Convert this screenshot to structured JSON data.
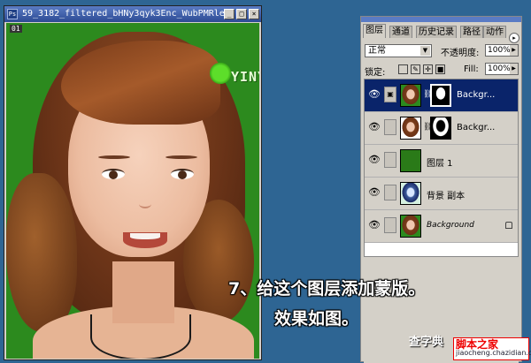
{
  "document": {
    "title": "59_3182_filtered_bHNy3qyk3Enc_WubPMRle...",
    "layer_tag": "01",
    "minimize": "_",
    "maximize": "□",
    "close": "×"
  },
  "logo": {
    "text": "YINYIN"
  },
  "panel": {
    "tabs": [
      "图层",
      "通道",
      "历史记录",
      "路径",
      "动作"
    ],
    "menu_button": "▸",
    "blend_mode": "正常",
    "opacity_label": "不透明度:",
    "opacity_value": "100%",
    "lock_label": "锁定:",
    "fill_label": "Fill:",
    "fill_value": "100%",
    "layers": [
      {
        "name": "Backgr...",
        "selected": true,
        "has_mask": true
      },
      {
        "name": "Backgr...",
        "selected": false,
        "has_mask": true
      },
      {
        "name": "图层 1",
        "selected": false,
        "has_mask": false
      },
      {
        "name": "背景 副本",
        "selected": false,
        "has_mask": false
      },
      {
        "name": "Background",
        "selected": false,
        "has_mask": false,
        "locked": true
      }
    ]
  },
  "caption": {
    "line1": "7、给这个图层添加蒙版。",
    "line2": "效果如图。"
  },
  "watermark": {
    "top": "脚本之家",
    "bottom": "jiaocheng.chazidian.com",
    "left": "查字典"
  },
  "colors": {
    "background": "#2e6593",
    "canvas_green": "#2c8a1e",
    "selection": "#0a246a"
  }
}
